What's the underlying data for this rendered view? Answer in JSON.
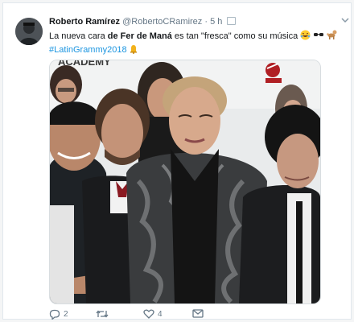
{
  "tweet": {
    "author_name": "Roberto Ramírez",
    "handle": "@RobertoCRamirez",
    "separator": "·",
    "time": "5 h",
    "text_pre": "La nueva cara ",
    "text_bold": "de Fer de Maná",
    "text_post": " es tan \"fresca\" como su música",
    "hashtag": "#LatinGrammy2018"
  },
  "photo": {
    "backdrop_text": "ACADEMY"
  },
  "actions": {
    "reply_count": "2",
    "retweet_count": "",
    "like_count": "4"
  },
  "colors": {
    "link": "#1b95e0",
    "muted": "#657786",
    "text": "#14171a"
  },
  "icons": [
    "reply-icon",
    "retweet-icon",
    "like-icon",
    "message-icon",
    "chevron-down-icon",
    "laughing-emoji",
    "sunglasses-emoji",
    "poodle-emoji",
    "bell-emoji"
  ]
}
